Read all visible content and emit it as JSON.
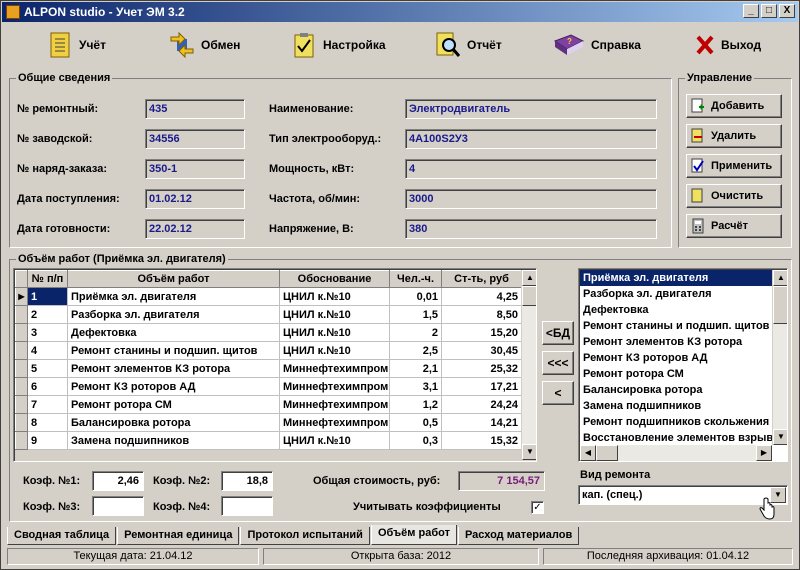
{
  "window": {
    "title": "ALPON studio - Учет ЭМ 3.2",
    "min": "_",
    "max": "□",
    "close": "X"
  },
  "toolbar": [
    {
      "label": "Учёт",
      "icon": "ledger-icon"
    },
    {
      "label": "Обмен",
      "icon": "exchange-arrows-icon"
    },
    {
      "label": "Настройка",
      "icon": "clipboard-check-icon"
    },
    {
      "label": "Отчёт",
      "icon": "report-magnifier-icon"
    },
    {
      "label": "Справка",
      "icon": "help-book-icon"
    },
    {
      "label": "Выход",
      "icon": "exit-x-icon"
    }
  ],
  "general": {
    "title": "Общие сведения",
    "repair_no_label": "№ ремонтный:",
    "repair_no": "435",
    "factory_no_label": "№ заводской:",
    "factory_no": "34556",
    "order_no_label": "№ наряд-заказа:",
    "order_no": "350-1",
    "received_label": "Дата поступления:",
    "received": "01.02.12",
    "ready_label": "Дата готовности:",
    "ready": "22.02.12",
    "name_label": "Наименование:",
    "name": "Электродвигатель",
    "type_label": "Тип электрооборуд.:",
    "type": "4А100S2У3",
    "power_label": "Мощность, кВт:",
    "power": "4",
    "freq_label": "Частота, об/мин:",
    "freq": "3000",
    "voltage_label": "Напряжение, В:",
    "voltage": "380"
  },
  "management": {
    "title": "Управление",
    "add": "Добавить",
    "delete": "Удалить",
    "apply": "Применить",
    "clear": "Очистить",
    "calc": "Расчёт"
  },
  "works": {
    "title": "Объём работ (Приёмка эл. двигателя)",
    "headers": [
      "№ п/п",
      "Объём работ",
      "Обоснование",
      "Чел.-ч.",
      "Ст-ть, руб"
    ],
    "rows": [
      [
        "1",
        "Приёмка эл. двигателя",
        "ЦНИЛ к.№10",
        "0,01",
        "4,25"
      ],
      [
        "2",
        "Разборка эл. двигателя",
        "ЦНИЛ к.№10",
        "1,5",
        "8,50"
      ],
      [
        "3",
        "Дефектовка",
        "ЦНИЛ к.№10",
        "2",
        "15,20"
      ],
      [
        "4",
        "Ремонт станины и подшип. щитов",
        "ЦНИЛ к.№10",
        "2,5",
        "30,45"
      ],
      [
        "5",
        "Ремонт элементов  КЗ ротора",
        "Миннефтехимпром",
        "2,1",
        "25,32"
      ],
      [
        "6",
        "Ремонт КЗ роторов АД",
        "Миннефтехимпром",
        "3,1",
        "17,21"
      ],
      [
        "7",
        "Ремонт ротора СМ",
        "Миннефтехимпром",
        "1,2",
        "24,24"
      ],
      [
        "8",
        "Балансировка ротора",
        "Миннефтехимпром",
        "0,5",
        "14,21"
      ],
      [
        "9",
        "Замена подшипников",
        "ЦНИЛ к.№10",
        "0,3",
        "15,32"
      ]
    ]
  },
  "nav": {
    "to_db": "<БД",
    "all_left": "<<<",
    "left": "<"
  },
  "catalog": [
    "Приёмка эл. двигателя",
    "Разборка эл. двигателя",
    "Дефектовка",
    "Ремонт станины и подшип. щитов",
    "Ремонт элементов  КЗ ротора",
    "Ремонт КЗ роторов АД",
    "Ремонт ротора СМ",
    "Балансировка ротора",
    "Замена подшипников",
    "Ремонт подшипников скольжения",
    "Восстановление элементов взрывозащиты"
  ],
  "coef": {
    "k1_label": "Коэф. №1:",
    "k1": "2,46",
    "k2_label": "Коэф. №2:",
    "k2": "18,8",
    "k3_label": "Коэф. №3:",
    "k3": "",
    "k4_label": "Коэф. №4:",
    "k4": "",
    "total_label": "Общая стоимость, руб:",
    "total": "7 154,57",
    "use_coef_label": "Учитывать коэффициенты",
    "use_coef_mark": "✓"
  },
  "repair_kind": {
    "label": "Вид ремонта",
    "value": "кап. (спец.)"
  },
  "tabs": [
    "Сводная таблица",
    "Ремонтная единица",
    "Протокол испытаний",
    "Объём работ",
    "Расход материалов"
  ],
  "status": {
    "date": "Текущая дата: 21.04.12",
    "base": "Открыта база: 2012",
    "archive": "Последняя архивация: 01.04.12"
  },
  "colors": {
    "title_start": "#0a246a",
    "title_end": "#a6caf0",
    "value_text": "#1a1a8c",
    "total_text": "#7a1a7a",
    "selection": "#0a246a"
  }
}
